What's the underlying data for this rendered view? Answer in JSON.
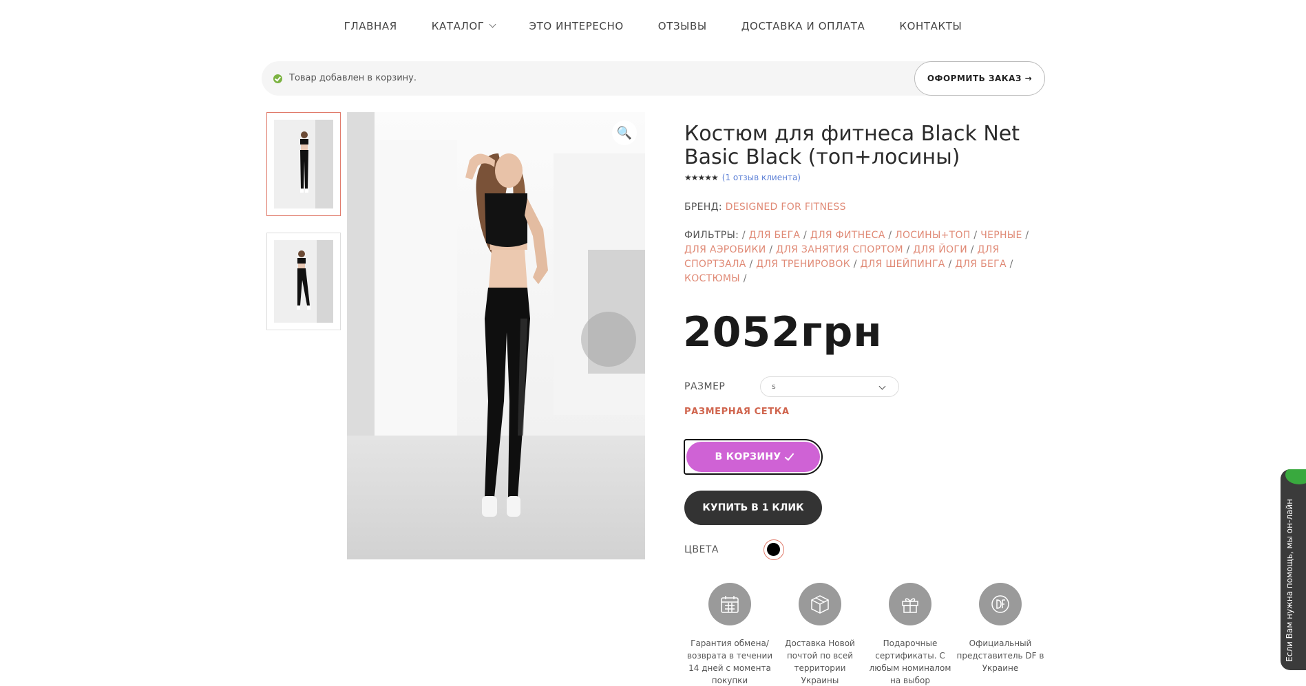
{
  "nav": {
    "items": [
      {
        "label": "ГЛАВНАЯ"
      },
      {
        "label": "КАТАЛОГ"
      },
      {
        "label": "ЭТО ИНТЕРЕСНО"
      },
      {
        "label": "ОТЗЫВЫ"
      },
      {
        "label": "ДОСТАВКА И ОПЛАТА"
      },
      {
        "label": "КОНТАКТЫ"
      }
    ]
  },
  "notice": {
    "message": "Товар добавлен в корзину.",
    "checkout_label": "ОФОРМИТЬ ЗАКАЗ →"
  },
  "product": {
    "title": "Костюм для фитнеса Black Net Basic Black (топ+лосины)",
    "stars": "★★★★★",
    "reviews_link": "(1 отзыв клиента)",
    "brand_label": "БРЕНД:",
    "brand_value": "DESIGNED FOR FITNESS",
    "filters_label": "ФИЛЬТРЫ:",
    "filters": [
      "ДЛЯ БЕГА",
      "ДЛЯ ФИТНЕСА",
      "ЛОСИНЫ+ТОП",
      "ЧЕРНЫЕ",
      "ДЛЯ АЭРОБИКИ",
      "ДЛЯ ЗАНЯТИЯ СПОРТОМ",
      "ДЛЯ ЙОГИ",
      "ДЛЯ СПОРТЗАЛА",
      "ДЛЯ ТРЕНИРОВОК",
      "ДЛЯ ШЕЙПИНГА",
      "ДЛЯ БЕГА",
      "КОСТЮМЫ"
    ],
    "price": "2052грн",
    "size_label": "РАЗМЕР",
    "size_value": "s",
    "size_chart_link": "РАЗМЕРНАЯ СЕТКА",
    "add_to_cart": "В КОРЗИНУ",
    "buy_one_click": "КУПИТЬ В 1 КЛИК",
    "colors_label": "ЦВЕТА",
    "selected_color": "#000000"
  },
  "features": [
    {
      "icon": "calendar-icon",
      "text": "Гарантия обмена/ возврата в течении 14 дней с момента покупки"
    },
    {
      "icon": "package-icon",
      "text": "Доставка Новой почтой по всей территории Украины"
    },
    {
      "icon": "gift-icon",
      "text": "Подарочные сертификаты. С любым номиналом на выбор"
    },
    {
      "icon": "df-logo-icon",
      "text": "Официальный представитель DF в Украине"
    }
  ],
  "chat": {
    "label": "Если Вам нужна помощь, мы он-лайн"
  },
  "colors": {
    "accent": "#e08a76",
    "cart_button": "#cf62d5",
    "size_chart": "#d0654e",
    "success": "#7cb342"
  }
}
